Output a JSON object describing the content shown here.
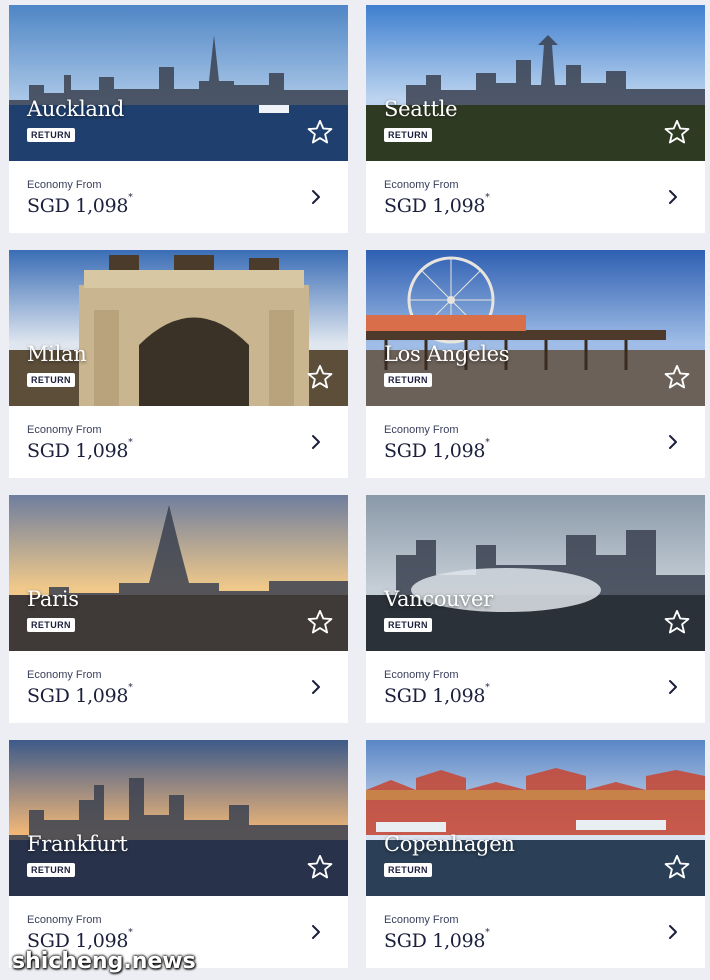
{
  "cards": [
    {
      "city": "Auckland",
      "badge": "RETURN",
      "label": "Economy From",
      "currency": "SGD",
      "price": "1,098",
      "note": "*",
      "sky": "#4f86c6",
      "sky2": "#a9c6e6",
      "ground": "#1f3f6e",
      "accent": "#cfd6de"
    },
    {
      "city": "Seattle",
      "badge": "RETURN",
      "label": "Economy From",
      "currency": "SGD",
      "price": "1,098",
      "note": "*",
      "sky": "#3f7fcf",
      "sky2": "#bcd4ef",
      "ground": "#2f3a23",
      "accent": "#b9b4a6"
    },
    {
      "city": "Milan",
      "badge": "RETURN",
      "label": "Economy From",
      "currency": "SGD",
      "price": "1,098",
      "note": "*",
      "sky": "#3a6db6",
      "sky2": "#dfe6ef",
      "ground": "#5d4e3a",
      "accent": "#c9b58f"
    },
    {
      "city": "Los Angeles",
      "badge": "RETURN",
      "label": "Economy From",
      "currency": "SGD",
      "price": "1,098",
      "note": "*",
      "sky": "#2f5fb2",
      "sky2": "#9fbde6",
      "ground": "#6b6158",
      "accent": "#e6d8c0"
    },
    {
      "city": "Paris",
      "badge": "RETURN",
      "label": "Economy From",
      "currency": "SGD",
      "price": "1,098",
      "note": "*",
      "sky": "#6f7e9e",
      "sky2": "#f0c98a",
      "ground": "#3f3a38",
      "accent": "#a58f78"
    },
    {
      "city": "Vancouver",
      "badge": "RETURN",
      "label": "Economy From",
      "currency": "SGD",
      "price": "1,098",
      "note": "*",
      "sky": "#8a99a8",
      "sky2": "#c5ced6",
      "ground": "#2a3138",
      "accent": "#9aa6b0"
    },
    {
      "city": "Frankfurt",
      "badge": "RETURN",
      "label": "Economy From",
      "currency": "SGD",
      "price": "1,098",
      "note": "*",
      "sky": "#3d5a8a",
      "sky2": "#f1b778",
      "ground": "#28324a",
      "accent": "#5f6d88"
    },
    {
      "city": "Copenhagen",
      "badge": "RETURN",
      "label": "Economy From",
      "currency": "SGD",
      "price": "1,098",
      "note": "*",
      "sky": "#5a86c6",
      "sky2": "#d9e4f0",
      "ground": "#2b3f57",
      "accent": "#c44a3a"
    }
  ],
  "watermark": "shicheng.news",
  "icons": {
    "favorite": "star-outline-icon",
    "more": "chevron-right-icon"
  }
}
